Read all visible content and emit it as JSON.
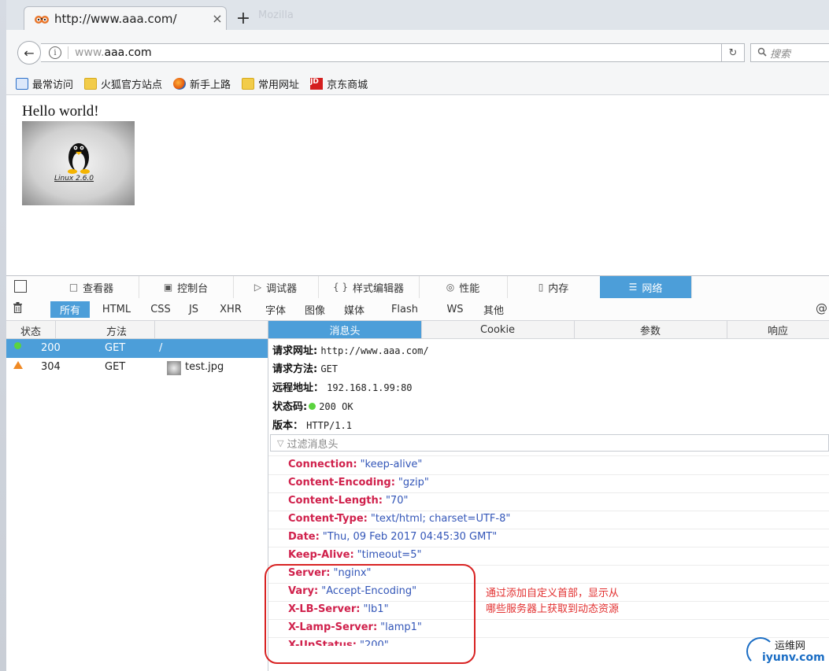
{
  "browser": {
    "tab_title": "http://www.aaa.com/",
    "tab_close": "×",
    "new_tab": "+",
    "ghost_tab": "Mozilla",
    "url_host_prefix": "www.",
    "url_host_main": "aaa.com",
    "search_placeholder": "搜索",
    "reload_glyph": "↻",
    "back_glyph": "←",
    "bookmarks": [
      "最常访问",
      "火狐官方站点",
      "新手上路",
      "常用网址",
      "京东商城"
    ],
    "bookmark_icons": [
      "recent-icon",
      "folder-icon",
      "firefox-icon",
      "folder-icon",
      "jd-icon"
    ]
  },
  "page": {
    "hello": "Hello world!",
    "image_caption": "Linux 2.6.0"
  },
  "devtools": {
    "tabs": [
      "查看器",
      "控制台",
      "调试器",
      "样式编辑器",
      "性能",
      "内存",
      "网络"
    ],
    "tab_icons": [
      "□",
      "▣",
      "▷",
      "{ }",
      "◎",
      "▯",
      "☰"
    ],
    "active_tab_index": 6,
    "filters": [
      "所有",
      "HTML",
      "CSS",
      "JS",
      "XHR",
      "字体",
      "图像",
      "媒体",
      "Flash",
      "WS",
      "其他"
    ],
    "active_filter_index": 0,
    "list_headers": {
      "status": "状态",
      "method": "方法"
    },
    "requests": [
      {
        "status": "200",
        "method": "GET",
        "file": "/",
        "status_color": "#5bd33f"
      },
      {
        "status": "304",
        "method": "GET",
        "file": "test.jpg",
        "status_color": "#f08a24"
      }
    ],
    "detail_tabs": [
      "消息头",
      "Cookie",
      "参数",
      "响应"
    ],
    "active_detail_index": 0,
    "summary": {
      "url_label": "请求网址:",
      "url_value": "http://www.aaa.com/",
      "method_label": "请求方法:",
      "method_value": "GET",
      "remote_label": "远程地址：",
      "remote_value": "192.168.1.99:80",
      "status_label": "状态码:",
      "status_value": "200 OK",
      "version_label": "版本：",
      "version_value": "HTTP/1.1"
    },
    "header_filter_placeholder": "过滤消息头",
    "headers": [
      {
        "name": "Connection:",
        "value": "\"keep-alive\""
      },
      {
        "name": "Content-Encoding:",
        "value": "\"gzip\""
      },
      {
        "name": "Content-Length:",
        "value": "\"70\""
      },
      {
        "name": "Content-Type:",
        "value": "\"text/html; charset=UTF-8\""
      },
      {
        "name": "Date:",
        "value": "\"Thu, 09 Feb 2017 04:45:30 GMT\""
      },
      {
        "name": "Keep-Alive:",
        "value": "\"timeout=5\""
      },
      {
        "name": "Server:",
        "value": "\"nginx\""
      },
      {
        "name": "Vary:",
        "value": "\"Accept-Encoding\""
      },
      {
        "name": "X-LB-Server:",
        "value": "\"lb1\""
      },
      {
        "name": "X-Lamp-Server:",
        "value": "\"lamp1\""
      },
      {
        "name": "X-UpStatus:",
        "value": "\"200\""
      }
    ]
  },
  "annotation": {
    "line1": "通过添加自定义首部，显示从",
    "line2": "哪些服务器上获取到动态资源",
    "color": "#e23030"
  },
  "watermark": {
    "line1": "运维网",
    "line2": "iyunv.com"
  }
}
